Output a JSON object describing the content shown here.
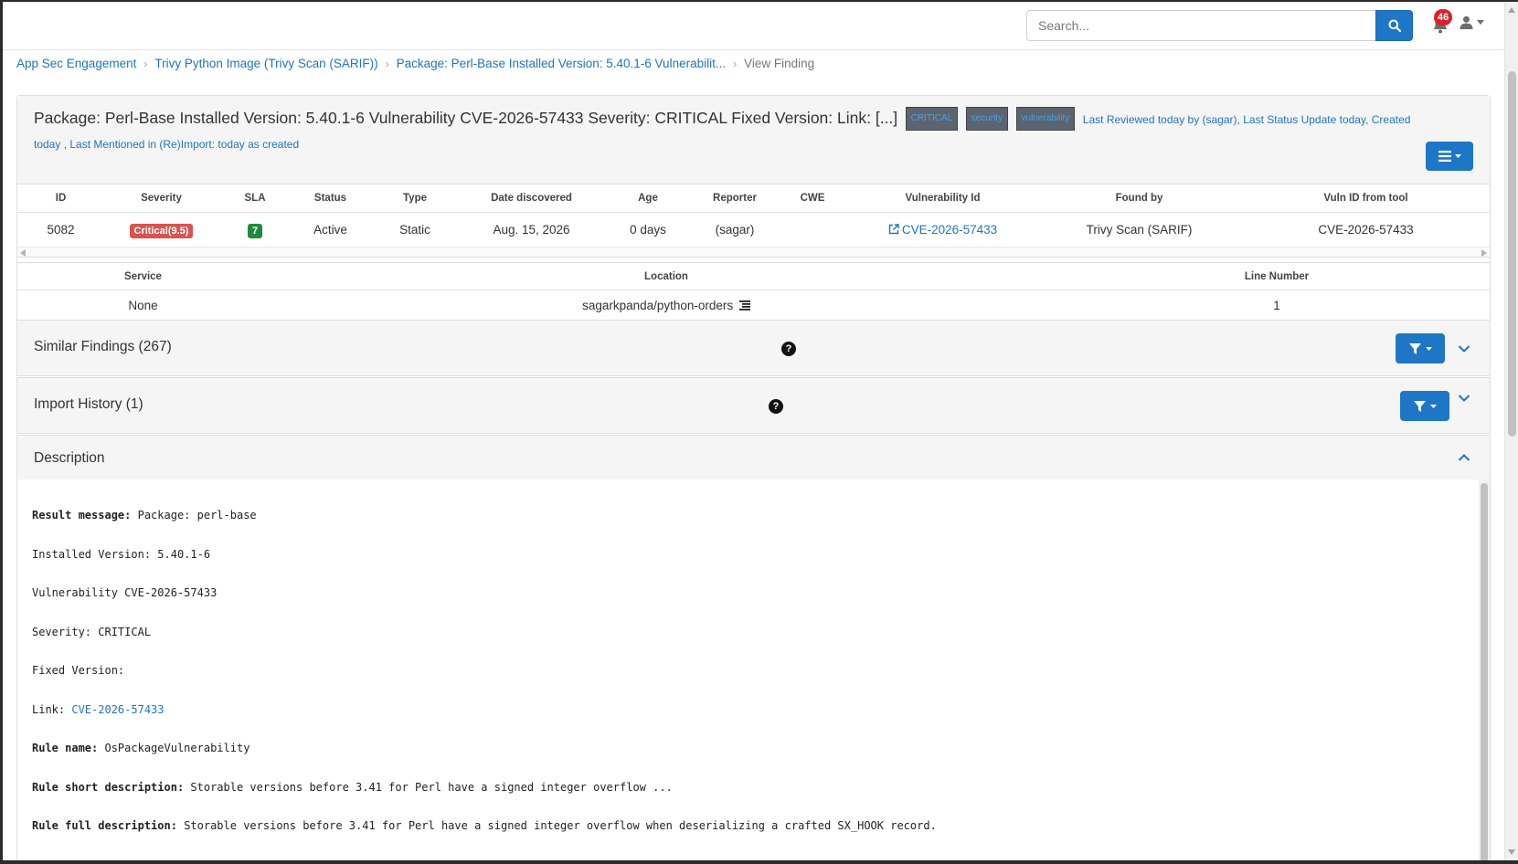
{
  "search": {
    "placeholder": "Search..."
  },
  "notifications": {
    "count": "46"
  },
  "breadcrumb": [
    "App Sec Engagement",
    "Trivy Python Image (Trivy Scan (SARIF))",
    "Package: Perl-Base Installed Version: 5.40.1-6 Vulnerabilit...",
    "View Finding"
  ],
  "finding": {
    "title": "Package: Perl-Base Installed Version: 5.40.1-6 Vulnerability CVE-2026-57433 Severity: CRITICAL Fixed Version: Link: [...]",
    "tags": [
      "CRITICAL",
      "security",
      "vulnerability"
    ],
    "meta_line1": "Last Reviewed today by (sagar), Last Status Update today, Created",
    "meta_line2": "today , Last Mentioned in (Re)Import: today as created"
  },
  "details_table": {
    "headers": [
      "ID",
      "Severity",
      "SLA",
      "Status",
      "Type",
      "Date discovered",
      "Age",
      "Reporter",
      "CWE",
      "Vulnerability Id",
      "Found by",
      "Vuln ID from tool"
    ],
    "row": {
      "id": "5082",
      "severity": "Critical(9.5)",
      "sla": "7",
      "status": "Active",
      "type": "Static",
      "date": "Aug. 15, 2026",
      "age": "0 days",
      "reporter": "(sagar)",
      "cwe": "",
      "vuln_id": "CVE-2026-57433",
      "found_by": "Trivy Scan (SARIF)",
      "vuln_tool": "CVE-2026-57433"
    }
  },
  "location_table": {
    "headers": [
      "Service",
      "Location",
      "Line Number"
    ],
    "row": {
      "service": "None",
      "location": "sagarkpanda/python-orders",
      "line": "1"
    }
  },
  "sections": {
    "similar": "Similar Findings (267)",
    "import": "Import History (1)",
    "description": "Description"
  },
  "description": {
    "result_label": "Result message:",
    "result_value": "Package: perl-base",
    "installed": "Installed Version: 5.40.1-6",
    "vulnerability": "Vulnerability CVE-2026-57433",
    "severity": "Severity: CRITICAL",
    "fixed": "Fixed Version:",
    "link_label": "Link:",
    "link_value": "CVE-2026-57433",
    "rule_name_label": "Rule name:",
    "rule_name_value": "OsPackageVulnerability",
    "rule_short_label": "Rule short description:",
    "rule_short_value": "Storable versions before 3.41 for Perl have a signed integer overflow  ...",
    "rule_full_label": "Rule full description:",
    "rule_full_value": "Storable versions before 3.41 for Perl have a signed integer overflow when deserializing a crafted SX_HOOK record."
  },
  "colors": {
    "primary": "#1e76c7",
    "danger": "#d9534f",
    "success": "#1f8a3b",
    "link": "#1f74c1"
  }
}
